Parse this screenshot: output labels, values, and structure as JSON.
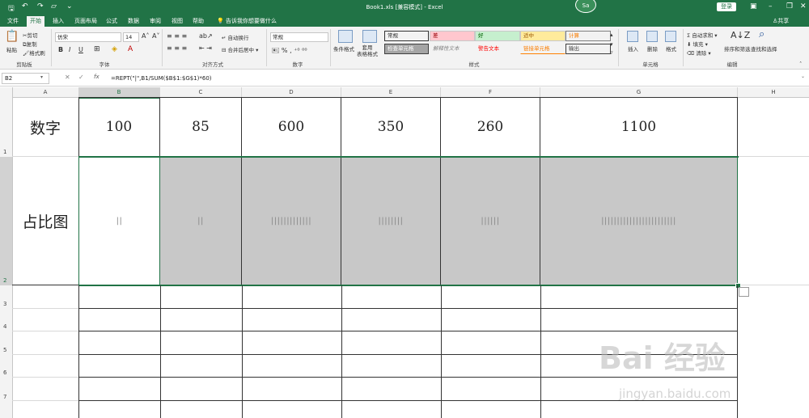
{
  "window": {
    "title": "Book1.xls  [兼容模式]  -  Excel",
    "login": "登录",
    "avatar": "Sa",
    "share": "共享",
    "tell_me": "告诉我你想要做什么"
  },
  "tabs": [
    "文件",
    "开始",
    "插入",
    "页面布局",
    "公式",
    "数据",
    "审阅",
    "视图",
    "帮助"
  ],
  "active_tab": "开始",
  "ribbon": {
    "clipboard": {
      "paste": "粘贴",
      "cut": "剪切",
      "copy": "复制",
      "format_painter": "格式刷",
      "label": "剪贴板"
    },
    "font": {
      "name": "仿宋",
      "size": "14",
      "label": "字体",
      "bold": "B",
      "italic": "I",
      "underline": "U"
    },
    "alignment": {
      "wrap": "自动换行",
      "merge": "合并后居中",
      "label": "对齐方式"
    },
    "number": {
      "format": "常规",
      "label": "数字"
    },
    "styles": {
      "cond_format": "条件格式",
      "table_format": "套用\n表格格式",
      "cells": [
        {
          "text": "常规",
          "bg": "#ffffff",
          "fg": "#000000"
        },
        {
          "text": "差",
          "bg": "#ffc7ce",
          "fg": "#9c0006"
        },
        {
          "text": "好",
          "bg": "#c6efce",
          "fg": "#006100"
        },
        {
          "text": "适中",
          "bg": "#ffeb9c",
          "fg": "#9c5700"
        },
        {
          "text": "计算",
          "bg": "#f2f2f2",
          "fg": "#fa7d00"
        },
        {
          "text": "检查单元格",
          "bg": "#a5a5a5",
          "fg": "#ffffff"
        },
        {
          "text": "解释性文本",
          "bg": "#ffffff",
          "fg": "#7f7f7f"
        },
        {
          "text": "警告文本",
          "bg": "#ffffff",
          "fg": "#ff0000"
        },
        {
          "text": "链接单元格",
          "bg": "#ffffff",
          "fg": "#fa7d00"
        },
        {
          "text": "输出",
          "bg": "#f2f2f2",
          "fg": "#3f3f3f"
        }
      ],
      "label": "样式"
    },
    "cells_group": {
      "insert": "插入",
      "delete": "删除",
      "format": "格式",
      "label": "单元格"
    },
    "editing": {
      "autosum": "自动求和",
      "fill": "填充",
      "clear": "清除",
      "sort": "排序和筛选",
      "find": "查找和选择",
      "label": "编辑"
    }
  },
  "formula_bar": {
    "name_box": "B2",
    "formula": "=REPT(\"|\",B1/SUM($B$1:$G$1)*60)",
    "fx": "fx"
  },
  "columns": [
    "A",
    "B",
    "C",
    "D",
    "E",
    "F",
    "G",
    "H"
  ],
  "rows": [
    "1",
    "2",
    "3",
    "4",
    "5",
    "6",
    "7"
  ],
  "sheet": {
    "row1_label": "数字",
    "row2_label": "占比图",
    "values": [
      "100",
      "85",
      "600",
      "350",
      "260",
      "1100"
    ],
    "bars": [
      "||",
      "||",
      "|||||||||||||",
      "||||||||",
      "||||||",
      "||||||||||||||||||||||||"
    ]
  },
  "watermark": {
    "main": "Bai 经验",
    "sub": "jingyan.baidu.com"
  },
  "colors": {
    "excel_green": "#217346",
    "selection": "#c8c8c8"
  }
}
